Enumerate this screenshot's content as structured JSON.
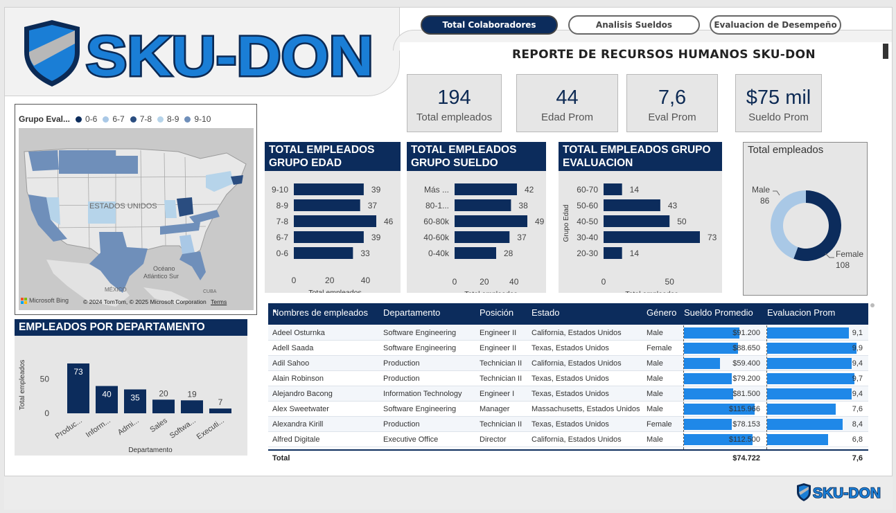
{
  "brand": {
    "name": "SKU-DON",
    "colors": {
      "navy": "#0c2c5c",
      "blue": "#1f88e8",
      "logo_blue": "#1a7ed6",
      "light": "#a9c8e6"
    }
  },
  "nav": {
    "tabs": [
      {
        "label": "Total Colaboradores",
        "active": true
      },
      {
        "label": "Analisis Sueldos",
        "active": false
      },
      {
        "label": "Evaluacion de Desempeño",
        "active": false
      }
    ]
  },
  "report_title": "REPORTE DE RECURSOS HUMANOS SKU-DON",
  "kpis": [
    {
      "value": "194",
      "label": "Total empleados"
    },
    {
      "value": "44",
      "label": "Edad Prom"
    },
    {
      "value": "7,6",
      "label": "Eval Prom"
    },
    {
      "value": "$75 mil",
      "label": "Sueldo Prom"
    }
  ],
  "map": {
    "legend_title": "Grupo Eval...",
    "legend": [
      {
        "label": "0-6",
        "color": "#0c2c5c"
      },
      {
        "label": "6-7",
        "color": "#a9c8e6"
      },
      {
        "label": "7-8",
        "color": "#2a4d80"
      },
      {
        "label": "8-9",
        "color": "#b6d4ea"
      },
      {
        "label": "9-10",
        "color": "#6f8fba"
      }
    ],
    "labels": {
      "country": "ESTADOS UNIDOS",
      "ocean": "Océano",
      "ocean2": "Atlántico Sur",
      "mexico": "MÉXICO",
      "cuba": "CUBA"
    },
    "attribution": "© 2024 TomTom, © 2025 Microsoft Corporation",
    "terms": "Terms",
    "provider": "Microsoft Bing"
  },
  "chart_data": [
    {
      "id": "edad",
      "type": "bar",
      "orientation": "horizontal",
      "title": "TOTAL EMPLEADOS GRUPO EDAD",
      "xlabel": "Total empleados",
      "categories": [
        "9-10",
        "8-9",
        "7-8",
        "6-7",
        "0-6"
      ],
      "values": [
        39,
        37,
        46,
        39,
        33
      ],
      "xticks": [
        "0",
        "20",
        "40"
      ],
      "xlim": [
        0,
        46
      ]
    },
    {
      "id": "sueldo",
      "type": "bar",
      "orientation": "horizontal",
      "title": "TOTAL EMPLEADOS GRUPO SUELDO",
      "xlabel": "Total empleados",
      "categories": [
        "Más ...",
        "80-1...",
        "60-80k",
        "40-60k",
        "0-40k"
      ],
      "values": [
        42,
        38,
        49,
        37,
        28
      ],
      "xticks": [
        "0",
        "20",
        "40"
      ],
      "xlim": [
        0,
        49
      ]
    },
    {
      "id": "evaluacion",
      "type": "bar",
      "orientation": "horizontal",
      "title": "TOTAL EMPLEADOS GRUPO EVALUACION",
      "xlabel": "Total empleados",
      "ylabel": "Grupo Edad",
      "categories": [
        "60-70",
        "50-60",
        "40-50",
        "30-40",
        "20-30"
      ],
      "values": [
        14,
        43,
        50,
        73,
        14
      ],
      "xticks": [
        "0",
        "50"
      ],
      "xlim": [
        0,
        73
      ]
    },
    {
      "id": "departamento",
      "type": "bar",
      "orientation": "vertical",
      "title": "EMPLEADOS POR DEPARTAMENTO",
      "xlabel": "Departamento",
      "ylabel": "Total empleados",
      "categories": [
        "Produc...",
        "Inform...",
        "Admi...",
        "Sales",
        "Softwa...",
        "Executi..."
      ],
      "values": [
        73,
        40,
        35,
        20,
        19,
        7
      ],
      "yticks": [
        "0",
        "50"
      ],
      "ylim": [
        0,
        73
      ]
    },
    {
      "id": "genero",
      "type": "pie",
      "variant": "donut",
      "title": "Total empleados",
      "slices": [
        {
          "label": "Male",
          "value": 86,
          "color": "#a9c8e6"
        },
        {
          "label": "Female",
          "value": 108,
          "color": "#0c2c5c"
        }
      ]
    }
  ],
  "table": {
    "columns": [
      "Nombres de empleados",
      "Departamento",
      "Posición",
      "Estado",
      "Género",
      "Sueldo Promedio",
      "Evaluacion Prom"
    ],
    "rows": [
      {
        "name": "Adeel Osturnka",
        "dept": "Software Engineering",
        "pos": "Engineer II",
        "state": "California, Estados Unidos",
        "gender": "Male",
        "salary": "$91.200",
        "salary_v": 91200,
        "eval": "9,1",
        "eval_v": 9.1
      },
      {
        "name": "Adell Saada",
        "dept": "Software Engineering",
        "pos": "Engineer II",
        "state": "Texas, Estados Unidos",
        "gender": "Female",
        "salary": "$88.650",
        "salary_v": 88650,
        "eval": "9,9",
        "eval_v": 9.9
      },
      {
        "name": "Adil Sahoo",
        "dept": "Production",
        "pos": "Technician II",
        "state": "California, Estados Unidos",
        "gender": "Male",
        "salary": "$59.400",
        "salary_v": 59400,
        "eval": "9,4",
        "eval_v": 9.4
      },
      {
        "name": "Alain Robinson",
        "dept": "Production",
        "pos": "Technician II",
        "state": "Texas, Estados Unidos",
        "gender": "Male",
        "salary": "$79.200",
        "salary_v": 79200,
        "eval": "9,7",
        "eval_v": 9.7
      },
      {
        "name": "Alejandro Bacong",
        "dept": "Information Technology",
        "pos": "Engineer I",
        "state": "Texas, Estados Unidos",
        "gender": "Male",
        "salary": "$81.500",
        "salary_v": 81500,
        "eval": "9,4",
        "eval_v": 9.4
      },
      {
        "name": "Alex Sweetwater",
        "dept": "Software Engineering",
        "pos": "Manager",
        "state": "Massachusetts, Estados Unidos",
        "gender": "Male",
        "salary": "$115.966",
        "salary_v": 115966,
        "eval": "7,6",
        "eval_v": 7.6
      },
      {
        "name": "Alexandra Kirill",
        "dept": "Production",
        "pos": "Technician II",
        "state": "Texas, Estados Unidos",
        "gender": "Female",
        "salary": "$78.153",
        "salary_v": 78153,
        "eval": "8,4",
        "eval_v": 8.4
      },
      {
        "name": "Alfred Digitale",
        "dept": "Executive Office",
        "pos": "Director",
        "state": "California, Estados Unidos",
        "gender": "Male",
        "salary": "$112.500",
        "salary_v": 112500,
        "eval": "6,8",
        "eval_v": 6.8
      }
    ],
    "total_label": "Total",
    "total_salary": "$74.722",
    "total_eval": "7,6",
    "salary_max": 130000,
    "eval_max": 10
  }
}
